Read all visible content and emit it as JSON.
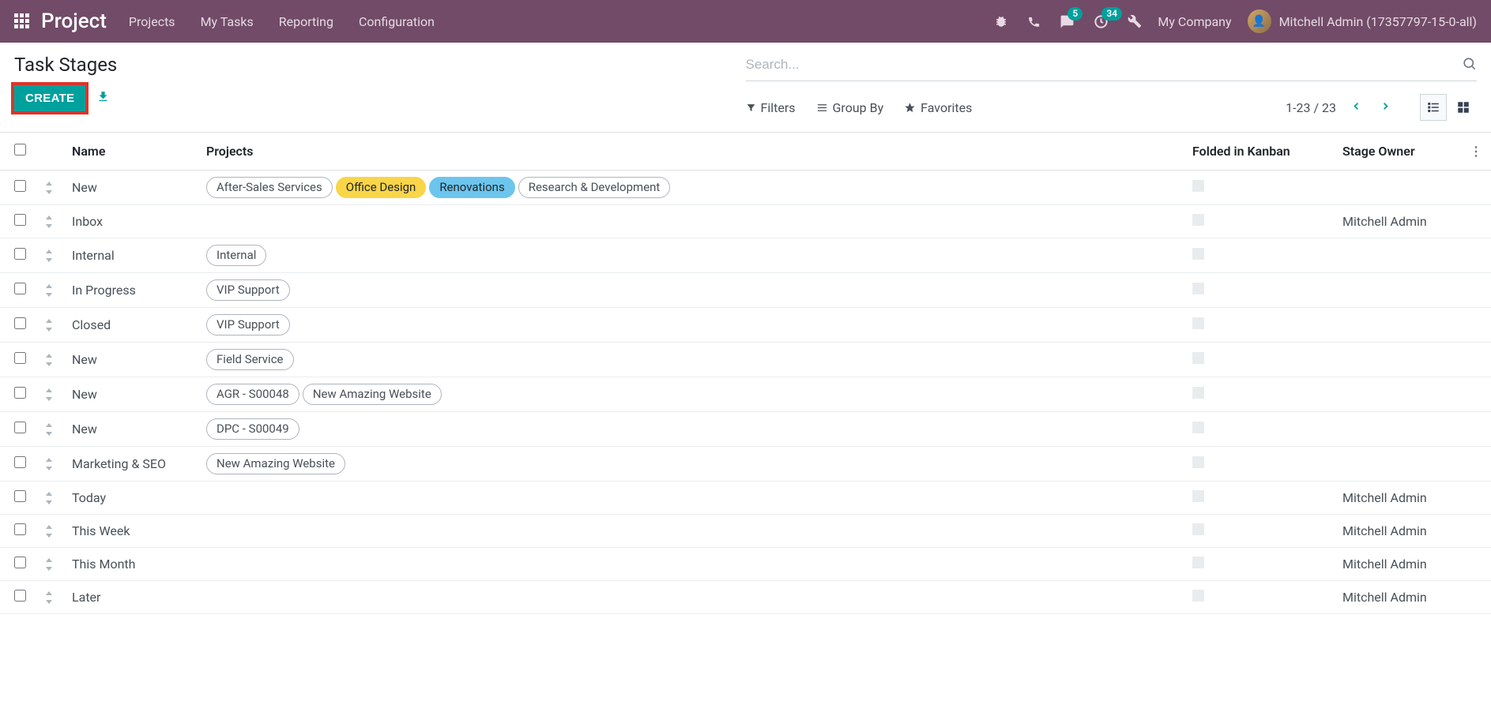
{
  "navbar": {
    "brand": "Project",
    "menu": [
      "Projects",
      "My Tasks",
      "Reporting",
      "Configuration"
    ],
    "messages_badge": "5",
    "activities_badge": "34",
    "company": "My Company",
    "user_name": "Mitchell Admin (17357797-15-0-all)"
  },
  "cp": {
    "title": "Task Stages",
    "create": "CREATE",
    "search_placeholder": "Search...",
    "filters": "Filters",
    "groupby": "Group By",
    "favorites": "Favorites",
    "pager": "1-23 / 23"
  },
  "columns": {
    "name": "Name",
    "projects": "Projects",
    "folded": "Folded in Kanban",
    "owner": "Stage Owner"
  },
  "rows": [
    {
      "name": "New",
      "projects": [
        {
          "t": "After-Sales Services",
          "c": ""
        },
        {
          "t": "Office Design",
          "c": "yellow"
        },
        {
          "t": "Renovations",
          "c": "blue"
        },
        {
          "t": "Research & Development",
          "c": ""
        }
      ],
      "owner": ""
    },
    {
      "name": "Inbox",
      "projects": [],
      "owner": "Mitchell Admin"
    },
    {
      "name": "Internal",
      "projects": [
        {
          "t": "Internal",
          "c": ""
        }
      ],
      "owner": ""
    },
    {
      "name": "In Progress",
      "projects": [
        {
          "t": "VIP Support",
          "c": ""
        }
      ],
      "owner": ""
    },
    {
      "name": "Closed",
      "projects": [
        {
          "t": "VIP Support",
          "c": ""
        }
      ],
      "owner": ""
    },
    {
      "name": "New",
      "projects": [
        {
          "t": "Field Service",
          "c": ""
        }
      ],
      "owner": ""
    },
    {
      "name": "New",
      "projects": [
        {
          "t": "AGR - S00048",
          "c": ""
        },
        {
          "t": "New Amazing Website",
          "c": ""
        }
      ],
      "owner": ""
    },
    {
      "name": "New",
      "projects": [
        {
          "t": "DPC - S00049",
          "c": ""
        }
      ],
      "owner": ""
    },
    {
      "name": "Marketing & SEO",
      "projects": [
        {
          "t": "New Amazing Website",
          "c": ""
        }
      ],
      "owner": ""
    },
    {
      "name": "Today",
      "projects": [],
      "owner": "Mitchell Admin"
    },
    {
      "name": "This Week",
      "projects": [],
      "owner": "Mitchell Admin"
    },
    {
      "name": "This Month",
      "projects": [],
      "owner": "Mitchell Admin"
    },
    {
      "name": "Later",
      "projects": [],
      "owner": "Mitchell Admin"
    }
  ]
}
